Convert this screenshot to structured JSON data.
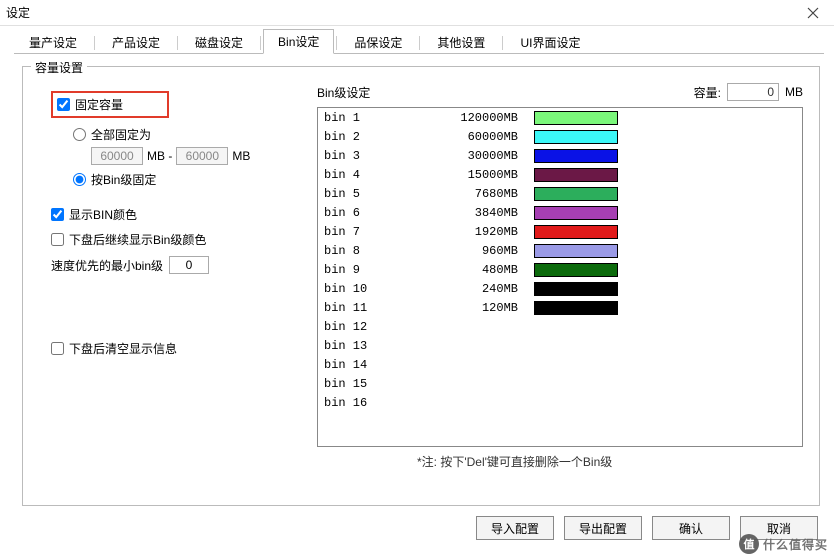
{
  "window": {
    "title": "设定"
  },
  "tabs": {
    "items": [
      {
        "label": "量产设定"
      },
      {
        "label": "产品设定"
      },
      {
        "label": "磁盘设定"
      },
      {
        "label": "Bin设定"
      },
      {
        "label": "品保设定"
      },
      {
        "label": "其他设置"
      },
      {
        "label": "UI界面设定"
      }
    ],
    "activeIndex": 3
  },
  "capacity": {
    "legend": "容量设置",
    "fixCapacity": {
      "label": "固定容量",
      "checked": true
    },
    "allFixedAs": {
      "label": "全部固定为",
      "selected": false
    },
    "range": {
      "from": "60000",
      "to": "60000",
      "mb_sep": "MB  -",
      "mb_end": "MB"
    },
    "byBin": {
      "label": "按Bin级固定",
      "selected": true
    },
    "showBinColor": {
      "label": "显示BIN颜色",
      "checked": true
    },
    "keepColorAfter": {
      "label": "下盘后继续显示Bin级颜色",
      "checked": false
    },
    "speedMinBin": {
      "label": "速度优先的最小bin级",
      "value": "0"
    },
    "clearAfter": {
      "label": "下盘后清空显示信息",
      "checked": false
    }
  },
  "binpanel": {
    "headerLabel": "Bin级设定",
    "capacityLabel": "容量:",
    "capacityValue": "0",
    "mb": "MB",
    "note": "*注: 按下'Del'键可直接删除一个Bin级",
    "bins": [
      {
        "name": "bin 1",
        "value": "120000MB",
        "color": "#7bf77b"
      },
      {
        "name": "bin 2",
        "value": "60000MB",
        "color": "#3bf7f7"
      },
      {
        "name": "bin 3",
        "value": "30000MB",
        "color": "#0a12e6"
      },
      {
        "name": "bin 4",
        "value": "15000MB",
        "color": "#6b1846"
      },
      {
        "name": "bin 5",
        "value": "7680MB",
        "color": "#2cae5c"
      },
      {
        "name": "bin 6",
        "value": "3840MB",
        "color": "#a63fb3"
      },
      {
        "name": "bin 7",
        "value": "1920MB",
        "color": "#e11a1a"
      },
      {
        "name": "bin 8",
        "value": "960MB",
        "color": "#9a9ae6"
      },
      {
        "name": "bin 9",
        "value": "480MB",
        "color": "#0c6b0c"
      },
      {
        "name": "bin 10",
        "value": "240MB",
        "color": "#000000"
      },
      {
        "name": "bin 11",
        "value": "120MB",
        "color": "#000000"
      },
      {
        "name": "bin 12",
        "value": "",
        "color": ""
      },
      {
        "name": "bin 13",
        "value": "",
        "color": ""
      },
      {
        "name": "bin 14",
        "value": "",
        "color": ""
      },
      {
        "name": "bin 15",
        "value": "",
        "color": ""
      },
      {
        "name": "bin 16",
        "value": "",
        "color": ""
      }
    ]
  },
  "footer": {
    "importCfg": "导入配置",
    "exportCfg": "导出配置",
    "ok": "确认",
    "cancel": "取消"
  },
  "watermark": {
    "badge": "值",
    "text": "什么值得买"
  }
}
